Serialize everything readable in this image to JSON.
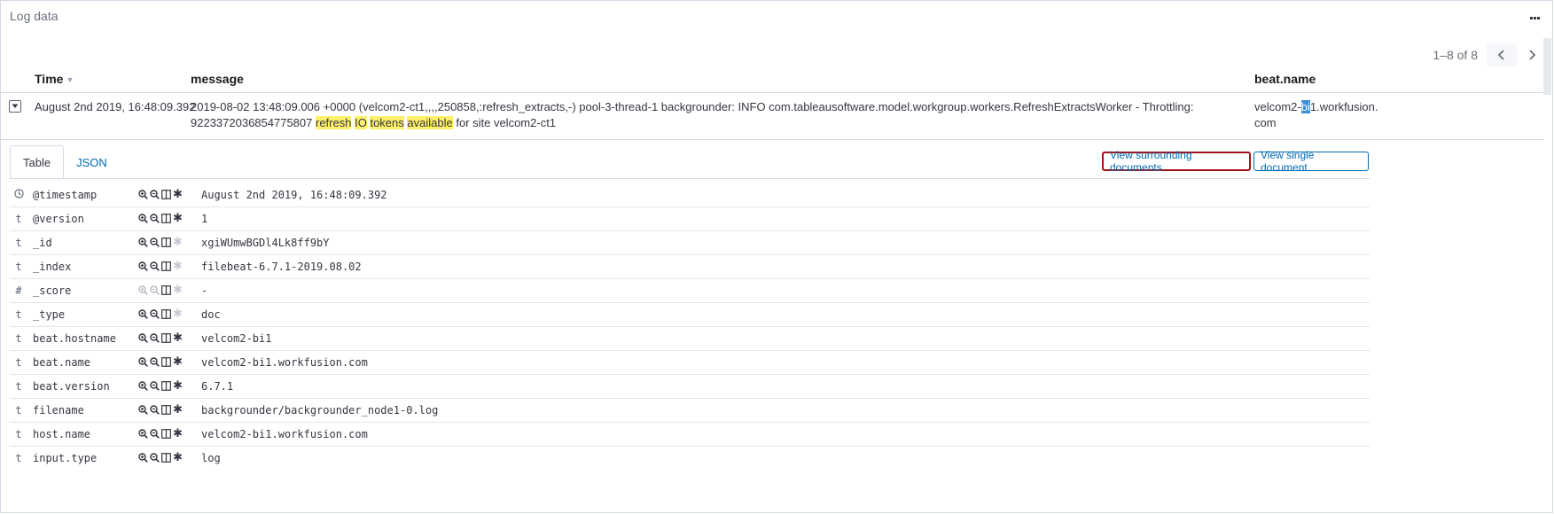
{
  "panel": {
    "title": "Log data",
    "options_icon": "more-icon"
  },
  "pagination": {
    "label": "1–8 of 8",
    "prev_icon": "chevron-left-icon",
    "next_icon": "chevron-right-icon"
  },
  "table": {
    "columns": {
      "time": "Time",
      "message": "message",
      "beat_name": "beat.name"
    },
    "row": {
      "time": "August 2nd 2019, 16:48:09.392",
      "message_pre": "2019-08-02 13:48:09.006 +0000 (velcom2-ct1,,,,250858,:refresh_extracts,-) pool-3-thread-1 backgrounder: INFO  com.tableausoftware.model.workgroup.workers.RefreshExtractsWorker - Throttling: 9223372036854775807 ",
      "hl_refresh": "refresh",
      "hl_io_1": "I",
      "hl_io_2": "O",
      "hl_tokens": "tokens",
      "hl_available": "available",
      "message_post": " for site velcom2-ct1",
      "beat_pre": "velcom2-",
      "beat_sel": "bi",
      "beat_post": "1.workfusion.",
      "beat_line2": "com"
    }
  },
  "details": {
    "tabs": [
      "Table",
      "JSON"
    ],
    "view_surrounding": "View surrounding documents",
    "view_single": "View single document",
    "fields": [
      {
        "type": "clock-icon",
        "name": "@timestamp",
        "value": "August 2nd 2019, 16:48:09.392",
        "filter_enabled": true,
        "exists_enabled": true
      },
      {
        "type": "t",
        "name": "@version",
        "value": "1",
        "filter_enabled": true,
        "exists_enabled": true
      },
      {
        "type": "t",
        "name": "_id",
        "value": "xgiWUmwBGDl4Lk8ff9bY",
        "filter_enabled": true,
        "exists_enabled": false
      },
      {
        "type": "t",
        "name": "_index",
        "value": "filebeat-6.7.1-2019.08.02",
        "filter_enabled": true,
        "exists_enabled": false
      },
      {
        "type": "#",
        "name": "_score",
        "value": " -",
        "filter_enabled": false,
        "exists_enabled": false
      },
      {
        "type": "t",
        "name": "_type",
        "value": "doc",
        "filter_enabled": true,
        "exists_enabled": false
      },
      {
        "type": "t",
        "name": "beat.hostname",
        "value": "velcom2-bi1",
        "filter_enabled": true,
        "exists_enabled": true
      },
      {
        "type": "t",
        "name": "beat.name",
        "value": "velcom2-bi1.workfusion.com",
        "filter_enabled": true,
        "exists_enabled": true
      },
      {
        "type": "t",
        "name": "beat.version",
        "value": "6.7.1",
        "filter_enabled": true,
        "exists_enabled": true
      },
      {
        "type": "t",
        "name": "filename",
        "value": "backgrounder/backgrounder_node1-0.log",
        "filter_enabled": true,
        "exists_enabled": true
      },
      {
        "type": "t",
        "name": "host.name",
        "value": "velcom2-bi1.workfusion.com",
        "filter_enabled": true,
        "exists_enabled": true
      },
      {
        "type": "t",
        "name": "input.type",
        "value": "log",
        "filter_enabled": true,
        "exists_enabled": true
      }
    ]
  },
  "colors": {
    "link": "#006bb4",
    "highlight": "#fff06a",
    "selection": "#3b8fd9",
    "emphasis_border": "#a3141b"
  }
}
